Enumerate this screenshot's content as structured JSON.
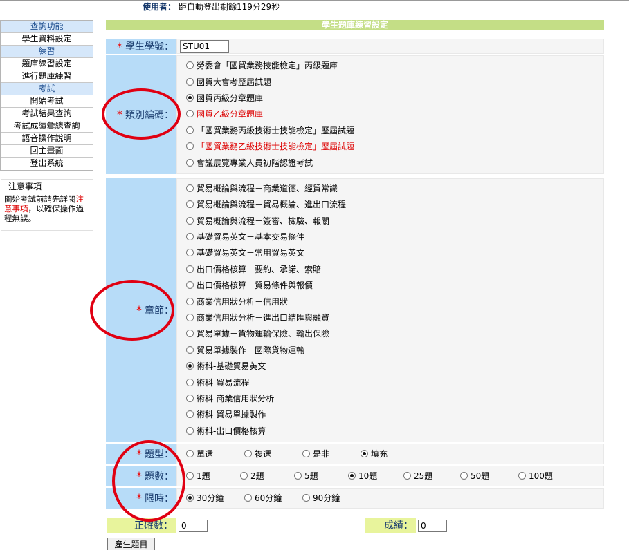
{
  "header": {
    "user_label": "使用者：",
    "user_value": "距自動登出剩餘119分29秒"
  },
  "sidebar": {
    "items": [
      {
        "label": "查詢功能",
        "type": "head"
      },
      {
        "label": "學生資料設定",
        "type": "item"
      },
      {
        "label": "練習",
        "type": "head"
      },
      {
        "label": "題庫練習設定",
        "type": "item"
      },
      {
        "label": "進行題庫練習",
        "type": "item"
      },
      {
        "label": "考試",
        "type": "head"
      },
      {
        "label": "開始考試",
        "type": "item"
      },
      {
        "label": "考試結果查詢",
        "type": "item"
      },
      {
        "label": "考試成績彙總查詢",
        "type": "item"
      },
      {
        "label": "語音操作說明",
        "type": "item"
      },
      {
        "label": "回主畫面",
        "type": "item"
      },
      {
        "label": "登出系統",
        "type": "item"
      }
    ]
  },
  "notice": {
    "title": "注意事項",
    "text_before": "開始考試前請先詳閱",
    "text_red": "注意事項",
    "text_after": "，以確保操作過程無誤。"
  },
  "page_title": "學生題庫練習設定",
  "form": {
    "student_id": {
      "label": "學生學號：",
      "value": "STU01"
    },
    "category": {
      "label": "類別編碼：",
      "options": [
        {
          "label": "勞委會「國貿業務技能檢定」丙級題庫",
          "selected": false,
          "red": false
        },
        {
          "label": "國貿大會考歷屆試題",
          "selected": false,
          "red": false
        },
        {
          "label": "國貿丙級分章題庫",
          "selected": true,
          "red": false
        },
        {
          "label": "國貿乙級分章題庫",
          "selected": false,
          "red": true
        },
        {
          "label": "「國貿業務丙級技術士技能檢定」歷屆試題",
          "selected": false,
          "red": false
        },
        {
          "label": "「國貿業務乙級技術士技能檢定」歷屆試題",
          "selected": false,
          "red": true
        },
        {
          "label": "會議展覽專業人員初階認證考試",
          "selected": false,
          "red": false
        }
      ]
    },
    "chapter": {
      "label": "章節：",
      "options": [
        {
          "label": "貿易概論與流程－商業道德、經貿常識",
          "selected": false
        },
        {
          "label": "貿易概論與流程－貿易概論、進出口流程",
          "selected": false
        },
        {
          "label": "貿易概論與流程－簽審、檢驗、報關",
          "selected": false
        },
        {
          "label": "基礎貿易英文－基本交易條件",
          "selected": false
        },
        {
          "label": "基礎貿易英文－常用貿易英文",
          "selected": false
        },
        {
          "label": "出口價格核算－要約、承諾、索賠",
          "selected": false
        },
        {
          "label": "出口價格核算－貿易條件與報價",
          "selected": false
        },
        {
          "label": "商業信用狀分析－信用狀",
          "selected": false
        },
        {
          "label": "商業信用狀分析－進出口結匯與融資",
          "selected": false
        },
        {
          "label": "貿易單據－貨物運輸保險、輸出保險",
          "selected": false
        },
        {
          "label": "貿易單據製作－國際貨物運輸",
          "selected": false
        },
        {
          "label": "術科-基礎貿易英文",
          "selected": true
        },
        {
          "label": "術科-貿易流程",
          "selected": false
        },
        {
          "label": "術科-商業信用狀分析",
          "selected": false
        },
        {
          "label": "術科-貿易單據製作",
          "selected": false
        },
        {
          "label": "術科-出口價格核算",
          "selected": false
        }
      ]
    },
    "qtype": {
      "label": "題型：",
      "options": [
        {
          "label": "單選",
          "selected": false
        },
        {
          "label": "複選",
          "selected": false
        },
        {
          "label": "是非",
          "selected": false
        },
        {
          "label": "填充",
          "selected": true
        }
      ]
    },
    "qcount": {
      "label": "題數：",
      "options": [
        {
          "label": "1題",
          "selected": false
        },
        {
          "label": "2題",
          "selected": false
        },
        {
          "label": "5題",
          "selected": false
        },
        {
          "label": "10題",
          "selected": true
        },
        {
          "label": "25題",
          "selected": false
        },
        {
          "label": "50題",
          "selected": false
        },
        {
          "label": "100題",
          "selected": false
        }
      ]
    },
    "time_limit": {
      "label": "限時：",
      "options": [
        {
          "label": "30分鐘",
          "selected": true
        },
        {
          "label": "60分鐘",
          "selected": false
        },
        {
          "label": "90分鐘",
          "selected": false
        }
      ]
    }
  },
  "results": {
    "correct_label": "正確數：",
    "correct_value": "0",
    "score_label": "成績：",
    "score_value": "0"
  },
  "generate_button": "產生題目",
  "annotation_color": "#e00012"
}
